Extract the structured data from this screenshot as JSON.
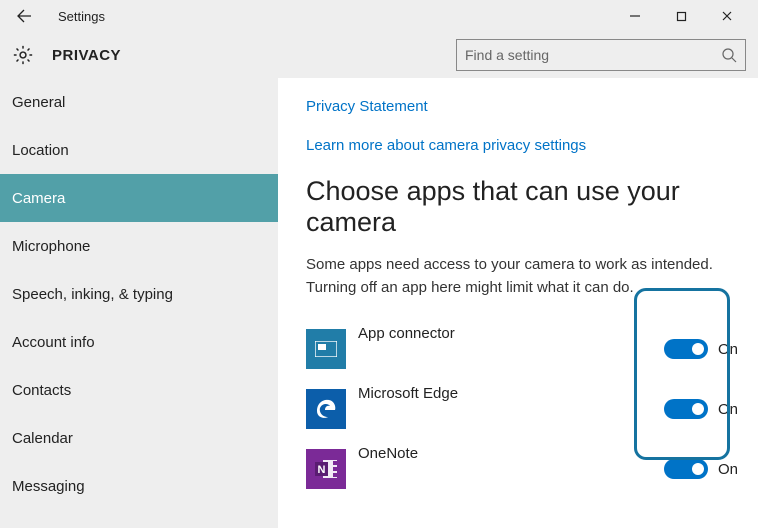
{
  "titlebar": {
    "title": "Settings"
  },
  "header": {
    "title": "PRIVACY"
  },
  "search": {
    "placeholder": "Find a setting"
  },
  "sidebar": {
    "items": [
      {
        "label": "General"
      },
      {
        "label": "Location"
      },
      {
        "label": "Camera"
      },
      {
        "label": "Microphone"
      },
      {
        "label": "Speech, inking, & typing"
      },
      {
        "label": "Account info"
      },
      {
        "label": "Contacts"
      },
      {
        "label": "Calendar"
      },
      {
        "label": "Messaging"
      }
    ],
    "selected_index": 2
  },
  "main": {
    "links": [
      "Privacy Statement",
      "Learn more about camera privacy settings"
    ],
    "section_heading": "Choose apps that can use your camera",
    "section_desc": "Some apps need access to your camera to work as intended. Turning off an app here might limit what it can do.",
    "apps": [
      {
        "name": "App connector",
        "state": "On",
        "icon": "app-connector",
        "bg": "#217da8",
        "fg": "#fff"
      },
      {
        "name": "Microsoft Edge",
        "state": "On",
        "icon": "edge",
        "bg": "#0c5eaa",
        "fg": "#fff"
      },
      {
        "name": "OneNote",
        "state": "On",
        "icon": "onenote",
        "bg": "#7b2a97",
        "fg": "#fff"
      }
    ]
  }
}
